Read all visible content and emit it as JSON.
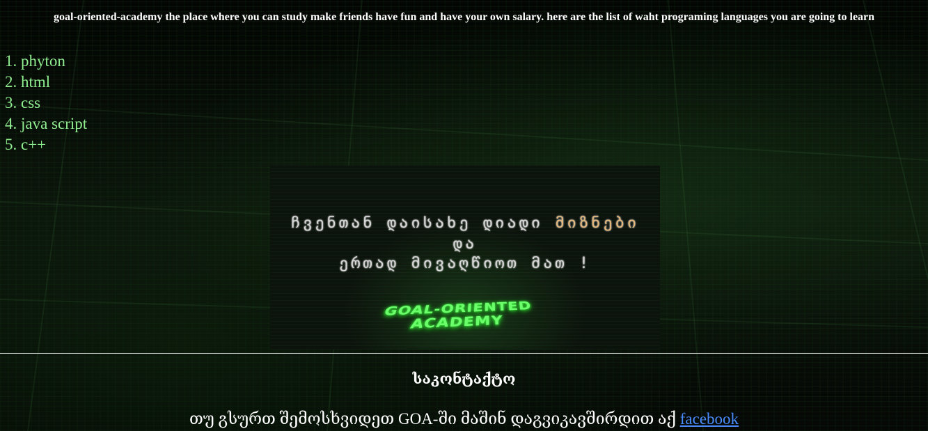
{
  "header": {
    "text": "goal-oriented-academy the place where you can study make friends have fun and have your own salary. here are the list of waht programing languages you are going to learn"
  },
  "languages": [
    "phyton",
    "html",
    "css",
    "java script",
    "c++"
  ],
  "banner": {
    "line1_main": "ჩვენთან დაისახე დიადი ",
    "line1_highlight": "მიზნები",
    "line2": "და",
    "line3": "ერთად მივაღწიოთ მათ !",
    "logo": "GOAL-ORIENTED ACADEMY"
  },
  "contact": {
    "title": "საკონტაქტო",
    "text": "თუ გსურთ შემოსხვიდეთ GOA-ში მაშინ დაგვიკავშირდით აქ ",
    "link_label": "facebook"
  },
  "colors": {
    "list_text": "#90ee90",
    "link": "#4a8cff",
    "banner_highlight": "#e8b878",
    "logo_glow": "#6cff6c"
  }
}
